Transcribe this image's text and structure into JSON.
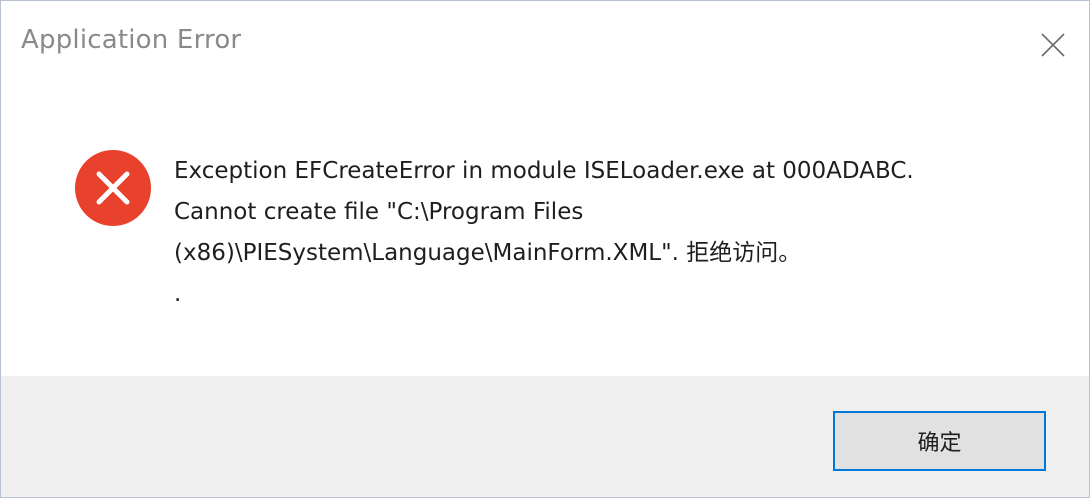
{
  "window": {
    "title": "Application Error",
    "close_icon": "close-icon"
  },
  "message": {
    "icon": "error-icon",
    "lines": [
      "Exception EFCreateError in module ISELoader.exe at 000ADABC.",
      "Cannot create file \"C:\\Program Files",
      "(x86)\\PIESystem\\Language\\MainForm.XML\". 拒绝访问。",
      "."
    ]
  },
  "buttons": {
    "ok_label": "确定"
  },
  "colors": {
    "error_red": "#e8412c",
    "button_focus_border": "#0078d7",
    "footer_bg": "#f0f0f0",
    "button_bg": "#e1e1e1"
  }
}
